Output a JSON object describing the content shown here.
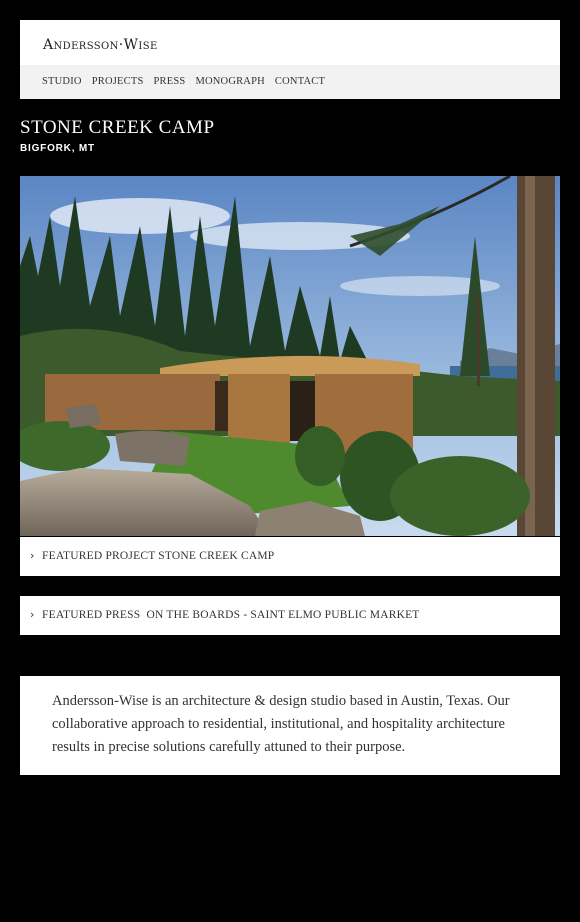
{
  "brand": {
    "logo_text": "Andersson·Wise"
  },
  "nav": {
    "items": [
      "STUDIO",
      "PROJECTS",
      "PRESS",
      "MONOGRAPH",
      "CONTACT"
    ]
  },
  "project": {
    "title": "STONE CREEK CAMP",
    "location": "BIGFORK, MT"
  },
  "featured_project": {
    "label": "FEATURED PROJECT STONE CREEK CAMP"
  },
  "featured_press": {
    "label": "FEATURED PRESS  ON THE BOARDS - SAINT ELMO PUBLIC MARKET"
  },
  "about": {
    "text": "Andersson-Wise is an architecture & design studio based in Austin, Texas. Our collaborative approach to residential, institutional, and hospitality architecture results in precise solutions carefully attuned to their purpose."
  },
  "icons": {
    "featured_arrow": "chevron-right-icon"
  }
}
